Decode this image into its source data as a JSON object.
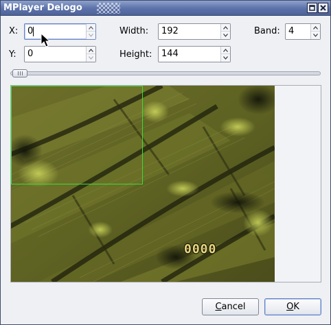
{
  "window": {
    "title": "MPlayer Delogo"
  },
  "fields": {
    "x": {
      "label": "X:",
      "value": "0"
    },
    "y": {
      "label": "Y:",
      "value": "0"
    },
    "width": {
      "label": "Width:",
      "value": "192"
    },
    "height": {
      "label": "Height:",
      "value": "144"
    },
    "band": {
      "label": "Band:",
      "value": "4"
    }
  },
  "slider": {
    "position": 0
  },
  "preview": {
    "overlay_text": "0000",
    "logo_region_color": "#36e136"
  },
  "buttons": {
    "cancel": {
      "first": "C",
      "rest": "ancel"
    },
    "ok": {
      "first": "O",
      "rest": "K"
    }
  },
  "colors": {
    "titlebar": "#5b71a8",
    "window_bg": "#eef0f4",
    "logo_rect": "#36e136"
  }
}
